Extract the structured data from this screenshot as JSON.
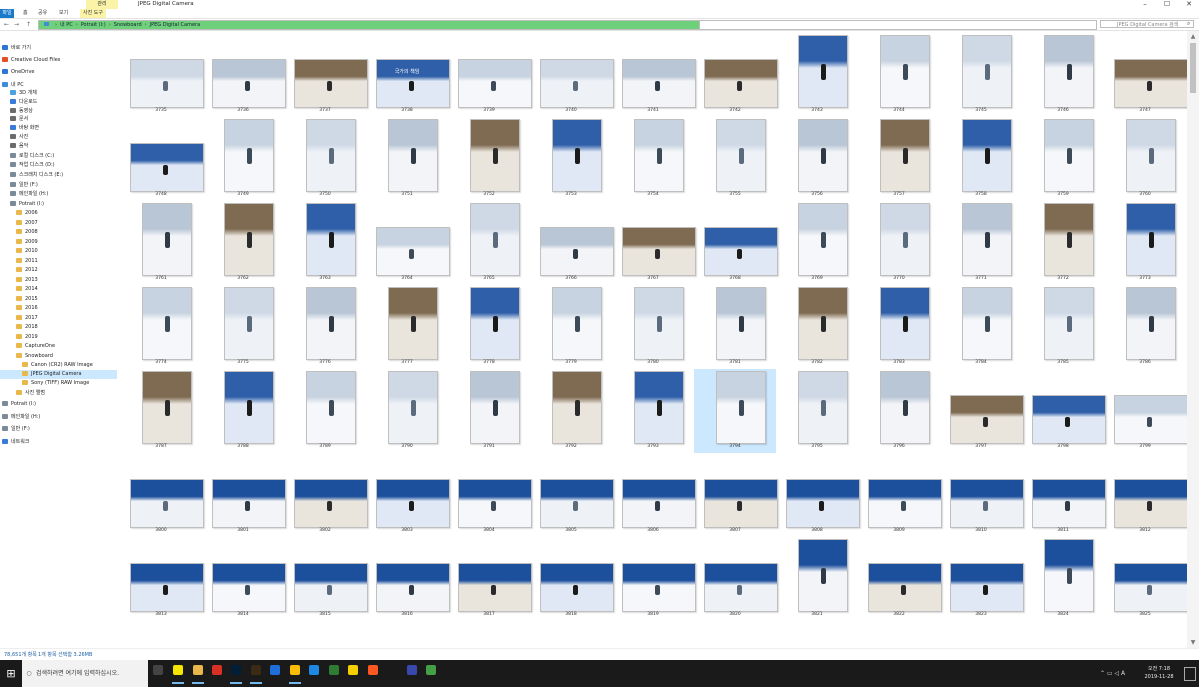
{
  "window": {
    "context_tab": "관리",
    "title": "JPEG Digital Camera",
    "controls": [
      "–",
      "☐",
      "✕"
    ]
  },
  "ribbon": {
    "tabs": [
      "파일",
      "홈",
      "공유",
      "보기",
      "사진 도구"
    ]
  },
  "address": {
    "back": "←",
    "forward": "→",
    "up": "↑",
    "crumbs": [
      "내 PC",
      "Potrait (I:)",
      "Snowboard",
      "JPEG Digital Camera"
    ],
    "search_placeholder": "JPEG Digital Camera 검색"
  },
  "sidebar": {
    "items": [
      {
        "label": "바로 가기",
        "color": "#2b78d4"
      },
      {
        "label": "Creative Cloud Files",
        "color": "#e34f26"
      },
      {
        "label": "OneDrive",
        "color": "#2b78d4"
      },
      {
        "label": "내 PC",
        "color": "#3f8dd9"
      },
      {
        "label": "3D 개체",
        "color": "#4aa3df"
      },
      {
        "label": "다운로드",
        "color": "#3a7bd5"
      },
      {
        "label": "동영상",
        "color": "#6c6c6c"
      },
      {
        "label": "문서",
        "color": "#6c6c6c"
      },
      {
        "label": "바탕 화면",
        "color": "#3a7bd5"
      },
      {
        "label": "사진",
        "color": "#6c6c6c"
      },
      {
        "label": "음악",
        "color": "#6c6c6c"
      },
      {
        "label": "로컬 디스크 (C:)",
        "color": "#7a8a99"
      },
      {
        "label": "작업 디스크 (D:)",
        "color": "#7a8a99"
      },
      {
        "label": "스크래치 디스크 (E:)",
        "color": "#7a8a99"
      },
      {
        "label": "일반 (F:)",
        "color": "#7a8a99"
      },
      {
        "label": "메인파일 (H:)",
        "color": "#7a8a99"
      },
      {
        "label": "Potrait (I:)",
        "color": "#7a8a99"
      },
      {
        "label": "2006",
        "color": "#e8b84a"
      },
      {
        "label": "2007",
        "color": "#e8b84a"
      },
      {
        "label": "2008",
        "color": "#e8b84a"
      },
      {
        "label": "2009",
        "color": "#e8b84a"
      },
      {
        "label": "2010",
        "color": "#e8b84a"
      },
      {
        "label": "2011",
        "color": "#e8b84a"
      },
      {
        "label": "2012",
        "color": "#e8b84a"
      },
      {
        "label": "2013",
        "color": "#e8b84a"
      },
      {
        "label": "2014",
        "color": "#e8b84a"
      },
      {
        "label": "2015",
        "color": "#e8b84a"
      },
      {
        "label": "2016",
        "color": "#e8b84a"
      },
      {
        "label": "2017",
        "color": "#e8b84a"
      },
      {
        "label": "2018",
        "color": "#e8b84a"
      },
      {
        "label": "2019",
        "color": "#e8b84a"
      },
      {
        "label": "CaptureOne",
        "color": "#e8b84a"
      },
      {
        "label": "Snowboard",
        "color": "#e8b84a"
      },
      {
        "label": "Canon (CR2) RAW Image",
        "color": "#e8b84a"
      },
      {
        "label": "JPEG Digital Camera",
        "color": "#e8b84a"
      },
      {
        "label": "Sony (TIFF) RAW Image",
        "color": "#e8b84a"
      },
      {
        "label": "사진 앨범",
        "color": "#e8b84a"
      },
      {
        "label": "Potrait (I:)",
        "color": "#7a8a99"
      },
      {
        "label": "메인파일 (H:)",
        "color": "#7a8a99"
      },
      {
        "label": "일반 (F:)",
        "color": "#7a8a99"
      },
      {
        "label": "네트워크",
        "color": "#3a7bd5"
      }
    ]
  },
  "grid": {
    "selected": "3794",
    "cover_text": "국가의 책임",
    "rows": [
      [
        "3735",
        "3736",
        "3737",
        "3738",
        "3739",
        "3740",
        "3741",
        "3742",
        "3743",
        "3744",
        "3745",
        "3746",
        "3747"
      ],
      [
        "3748",
        "3749",
        "3750",
        "3751",
        "3752",
        "3753",
        "3754",
        "3755",
        "3756",
        "3757",
        "3758",
        "3759",
        "3760"
      ],
      [
        "3761",
        "3762",
        "3763",
        "3764",
        "3765",
        "3766",
        "3767",
        "3768",
        "3769",
        "3770",
        "3771",
        "3772",
        "3773"
      ],
      [
        "3774",
        "3775",
        "3776",
        "3777",
        "3778",
        "3779",
        "3780",
        "3781",
        "3782",
        "3783",
        "3784",
        "3785",
        "3786"
      ],
      [
        "3787",
        "3788",
        "3789",
        "3790",
        "3791",
        "3792",
        "3793",
        "3794",
        "3795",
        "3796",
        "3797",
        "3798",
        "3799"
      ],
      [
        "3800",
        "3801",
        "3802",
        "3803",
        "3804",
        "3805",
        "3806",
        "3807",
        "3808",
        "3809",
        "3810",
        "3811",
        "3812"
      ],
      [
        "3813",
        "3814",
        "3815",
        "3816",
        "3817",
        "3818",
        "3819",
        "3820",
        "3821",
        "3822",
        "3823",
        "3824",
        "3825"
      ]
    ],
    "orient": [
      "LLLLLLLLPPPPL",
      "LPPPPPPPPPPPP",
      "PPPLPLLLPPPPP",
      "PPPPPPPPPPPPP",
      "PPPPPPPPPPLLL",
      "LLLLLLLLLLLLL",
      "LLLLLLLLPLLPL"
    ]
  },
  "status": {
    "count": "78,651개 항목",
    "selection": "1개 항목 선택함 3.26MB"
  },
  "taskbar": {
    "start": "⊞",
    "search_placeholder": "검색하려면 여기에 입력하십시오.",
    "time": "오전 7:18",
    "date": "2019-11-28",
    "apps": [
      {
        "name": "task-view",
        "color": "#444"
      },
      {
        "name": "kakaotalk",
        "color": "#f7e600"
      },
      {
        "name": "explorer",
        "color": "#e8b84a"
      },
      {
        "name": "app-red",
        "color": "#d93025"
      },
      {
        "name": "photoshop",
        "color": "#001e36"
      },
      {
        "name": "bridge",
        "color": "#3b2a14"
      },
      {
        "name": "info",
        "color": "#1e6fd9"
      },
      {
        "name": "chrome",
        "color": "#fbbc05"
      },
      {
        "name": "edge",
        "color": "#1e88e5"
      },
      {
        "name": "app-green",
        "color": "#2e7d32"
      },
      {
        "name": "app-yellow",
        "color": "#f4d000"
      },
      {
        "name": "app-orange",
        "color": "#ff5722"
      },
      {
        "name": "app-blue",
        "color": "#3949ab"
      },
      {
        "name": "app-cloud",
        "color": "#43a047"
      }
    ]
  }
}
